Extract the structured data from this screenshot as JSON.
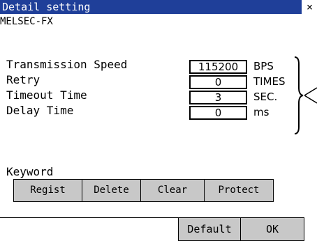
{
  "window": {
    "title": "Detail setting",
    "close_label": "×"
  },
  "device": {
    "name": "MELSEC-FX"
  },
  "settings": [
    {
      "label": "Transmission Speed",
      "value": "115200",
      "unit": "BPS"
    },
    {
      "label": "Retry",
      "value": "0",
      "unit": "TIMES"
    },
    {
      "label": "Timeout Time",
      "value": "3",
      "unit": "SEC."
    },
    {
      "label": "Delay Time",
      "value": "0",
      "unit": "ms"
    }
  ],
  "keyword": {
    "label": "Keyword",
    "buttons": [
      "Regist",
      "Delete",
      "Clear",
      "Protect"
    ]
  },
  "footer": {
    "default_label": "Default",
    "ok_label": "OK"
  }
}
